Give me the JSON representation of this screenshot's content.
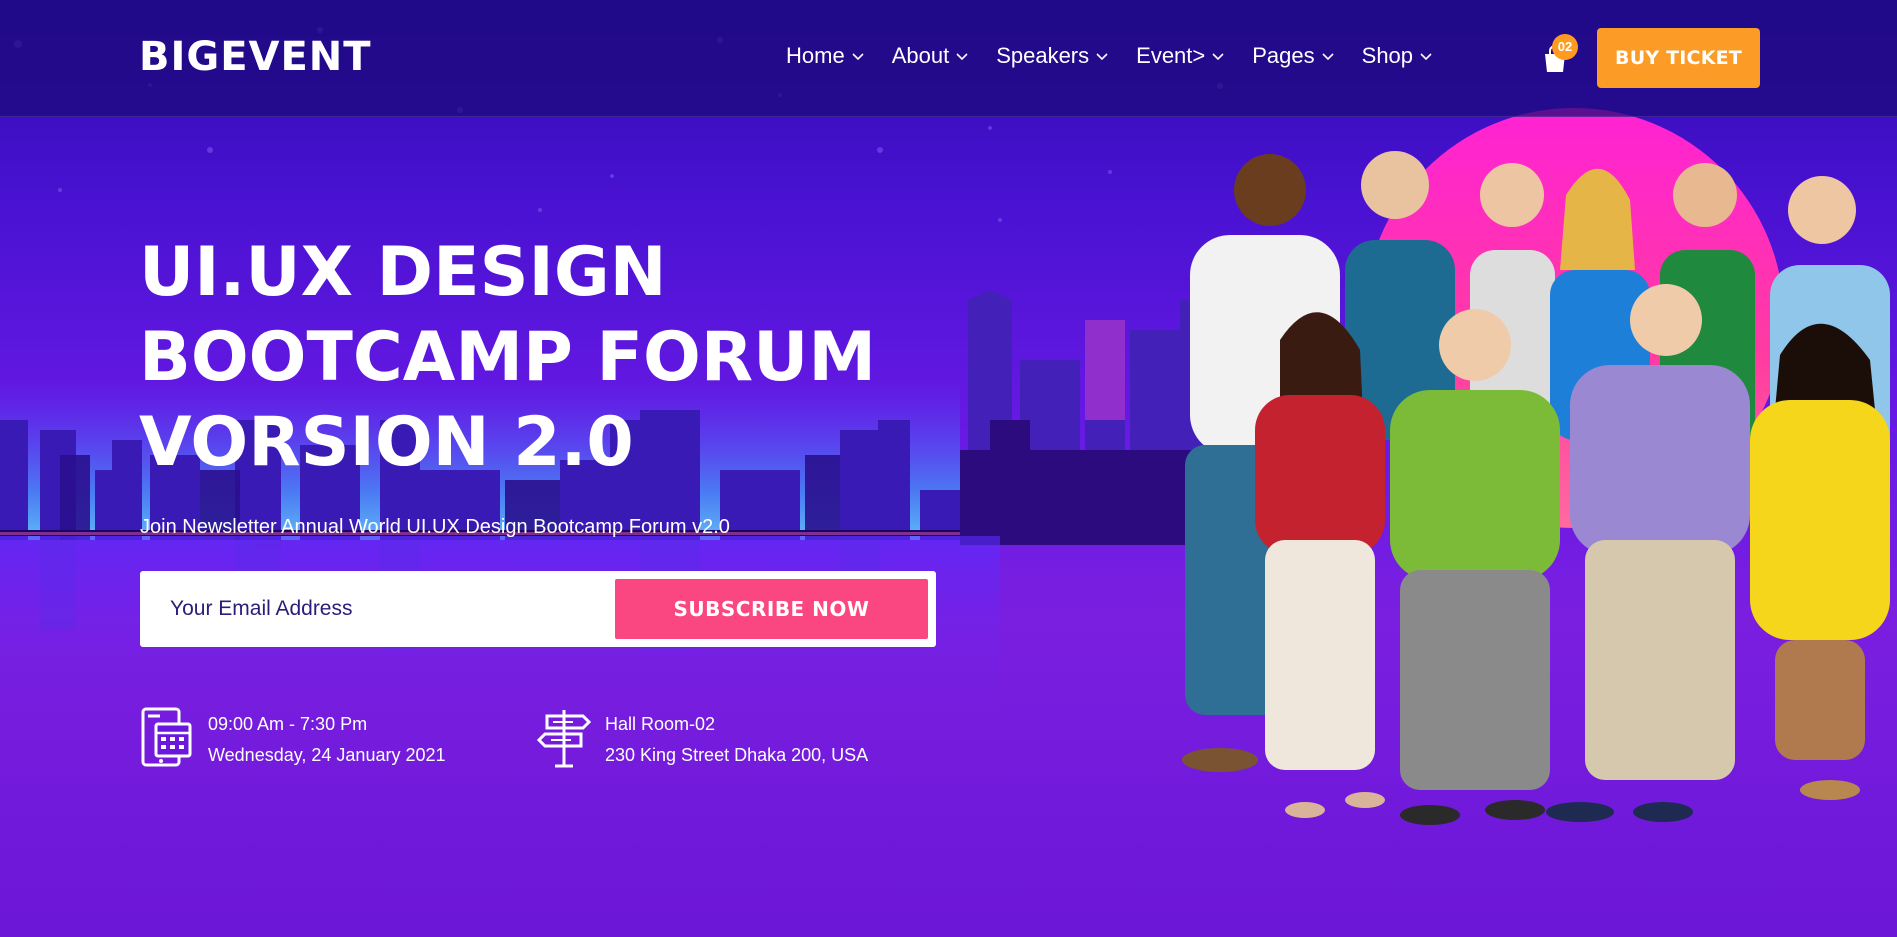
{
  "header": {
    "logo": "BIGEVENT",
    "nav": [
      {
        "label": "Home"
      },
      {
        "label": "About"
      },
      {
        "label": "Speakers"
      },
      {
        "label": "Event>"
      },
      {
        "label": "Pages"
      },
      {
        "label": "Shop"
      }
    ],
    "cart_count": "02",
    "buy_ticket_label": "BUY TICKET"
  },
  "hero": {
    "title_lines": [
      "UI.UX DESIGN",
      "BOOTCAMP FORUM",
      "VORSION 2.0"
    ],
    "subtitle": "Join Newsletter Annual World UI.UX Design Bootcamp Forum v2.0",
    "email_placeholder": "Your Email Address",
    "subscribe_label": "SUBSCRIBE NOW"
  },
  "info": {
    "time": "09:00 Am - 7:30 Pm",
    "date": "Wednesday, 24 January 2021",
    "venue": "Hall Room-02",
    "address": "230 King Street Dhaka 200, USA"
  },
  "icons": {
    "cart": "shopping-bag-icon",
    "calendar": "calendar-icon",
    "signpost": "signpost-icon",
    "chevron": "chevron-down-icon"
  },
  "colors": {
    "accent_orange": "#fc9b26",
    "accent_pink": "#fa4781",
    "hero_purple": "#6a18dc",
    "header_navy": "#1c0a78"
  }
}
